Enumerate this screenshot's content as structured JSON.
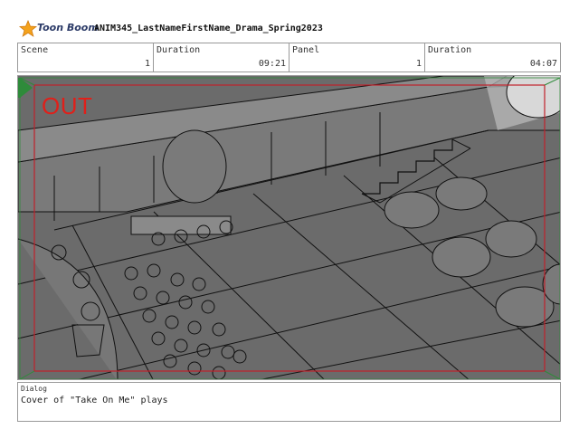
{
  "header": {
    "brand": "Toon Boom",
    "project_title": "ANIM345_LastNameFirstName_Drama_Spring2023"
  },
  "info": {
    "scene_label": "Scene",
    "scene_value": "1",
    "scene_duration_label": "Duration",
    "scene_duration_value": "09:21",
    "panel_label": "Panel",
    "panel_value": "1",
    "panel_duration_label": "Duration",
    "panel_duration_value": "04:07"
  },
  "panel": {
    "transition_label": "OUT"
  },
  "dialog": {
    "label": "Dialog",
    "text": "Cover of \"Take On Me\" plays"
  },
  "colors": {
    "safe_frame": "#c0202a",
    "field_guide": "#2e8b3a",
    "out_label": "#e0201a",
    "sketch_bg": "#6e6e6e"
  }
}
